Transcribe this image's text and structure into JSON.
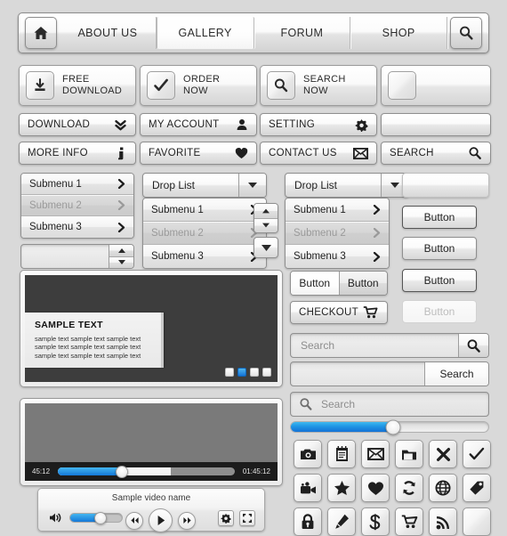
{
  "nav": {
    "home_icon": "home-icon",
    "search_icon": "search-icon",
    "items": [
      {
        "label": "ABOUT US",
        "active": false
      },
      {
        "label": "GALLERY",
        "active": true
      },
      {
        "label": "FORUM",
        "active": false
      },
      {
        "label": "SHOP",
        "active": false
      }
    ]
  },
  "icon_buttons": [
    {
      "line1": "FREE",
      "line2": "DOWNLOAD",
      "icon": "download-icon"
    },
    {
      "line1": "ORDER",
      "line2": "NOW",
      "icon": "check-icon"
    },
    {
      "line1": "SEARCH",
      "line2": "NOW",
      "icon": "search-icon"
    },
    {
      "line1": "",
      "line2": "",
      "icon": "blank-icon"
    }
  ],
  "label_buttons_row1": [
    {
      "label": "DOWNLOAD",
      "icon": "double-chevron-down-icon"
    },
    {
      "label": "MY ACCOUNT",
      "icon": "user-icon"
    },
    {
      "label": "SETTING",
      "icon": "gear-icon"
    },
    {
      "label": "",
      "icon": "blank-icon"
    }
  ],
  "label_buttons_row2": [
    {
      "label": "MORE INFO",
      "icon": "info-icon"
    },
    {
      "label": "FAVORITE",
      "icon": "heart-icon"
    },
    {
      "label": "CONTACT US",
      "icon": "envelope-icon"
    },
    {
      "label": "SEARCH",
      "icon": "search-icon"
    }
  ],
  "submenu_left": [
    {
      "label": "Submenu 1",
      "disabled": false
    },
    {
      "label": "Submenu 2",
      "disabled": true
    },
    {
      "label": "Submenu 3",
      "disabled": false
    }
  ],
  "droplist_mid": {
    "title": "Drop List",
    "caret_icon": "caret-down-icon",
    "items": [
      {
        "label": "Submenu 1",
        "disabled": false
      },
      {
        "label": "Submenu 2",
        "disabled": true
      },
      {
        "label": "Submenu 3",
        "disabled": false
      }
    ]
  },
  "droplist_right": {
    "title": "Drop List",
    "caret_icon": "caret-down-icon",
    "items": [
      {
        "label": "Submenu 1",
        "disabled": false
      },
      {
        "label": "Submenu 2",
        "disabled": true
      },
      {
        "label": "Submenu 3",
        "disabled": false
      }
    ]
  },
  "spinner": {
    "value": "",
    "up_icon": "caret-up-icon",
    "down_icon": "caret-down-icon"
  },
  "right_buttons": [
    {
      "label": "",
      "style": "blank"
    },
    {
      "label": "Button",
      "style": "dark"
    },
    {
      "label": "Button",
      "style": "mid"
    },
    {
      "label": "Button",
      "style": "dark"
    },
    {
      "label": "Button",
      "style": "disabled"
    }
  ],
  "toggle_group": [
    {
      "label": "Button",
      "active": true
    },
    {
      "label": "Button",
      "active": false
    }
  ],
  "checkout": {
    "label": "CHECKOUT",
    "icon": "cart-icon"
  },
  "searches": {
    "with_icon_button": {
      "value": "",
      "placeholder": "Search",
      "icon": "search-icon"
    },
    "with_text_button": {
      "value": "",
      "placeholder": "",
      "button_label": "Search"
    },
    "inset_with_icon": {
      "value": "",
      "placeholder": "Search",
      "icon": "search-icon"
    }
  },
  "slider": {
    "value": 52,
    "min": 0,
    "max": 100
  },
  "slideshow": {
    "caption_title": "SAMPLE TEXT",
    "caption_lines": [
      "sample text sample text sample text",
      "sample text sample text sample text",
      "sample text sample text sample text"
    ],
    "dots": [
      {
        "active": false
      },
      {
        "active": true
      },
      {
        "active": false
      },
      {
        "active": false
      }
    ]
  },
  "video": {
    "current_time": "45:12",
    "total_time": "01:45:12",
    "played_percent": 36,
    "buffered_percent": 64,
    "title": "Sample video name",
    "volume_percent": 58,
    "volume_icon": "speaker-icon",
    "rewind_icon": "rewind-icon",
    "play_icon": "play-icon",
    "forward_icon": "forward-icon",
    "settings_icon": "gear-icon",
    "fullscreen_icon": "fullscreen-icon"
  },
  "icon_grid": [
    "camera-icon",
    "notepad-icon",
    "envelope-icon",
    "folder-icon",
    "close-x-icon",
    "check-icon",
    "video-camera-icon",
    "star-icon",
    "heart-icon",
    "refresh-icon",
    "globe-icon",
    "tag-icon",
    "lock-icon",
    "pencil-icon",
    "dollar-icon",
    "cart-icon",
    "rss-icon",
    "blank-icon"
  ],
  "colors": {
    "background": "#d9d9d9",
    "accent_blue": "#1478d8",
    "accent_blue_light": "#44b5ef",
    "text": "#1f1f1f",
    "text_disabled": "#9a9a9a",
    "video_bar": "#1c1c1c",
    "slide_bg": "#3d3d3d"
  }
}
